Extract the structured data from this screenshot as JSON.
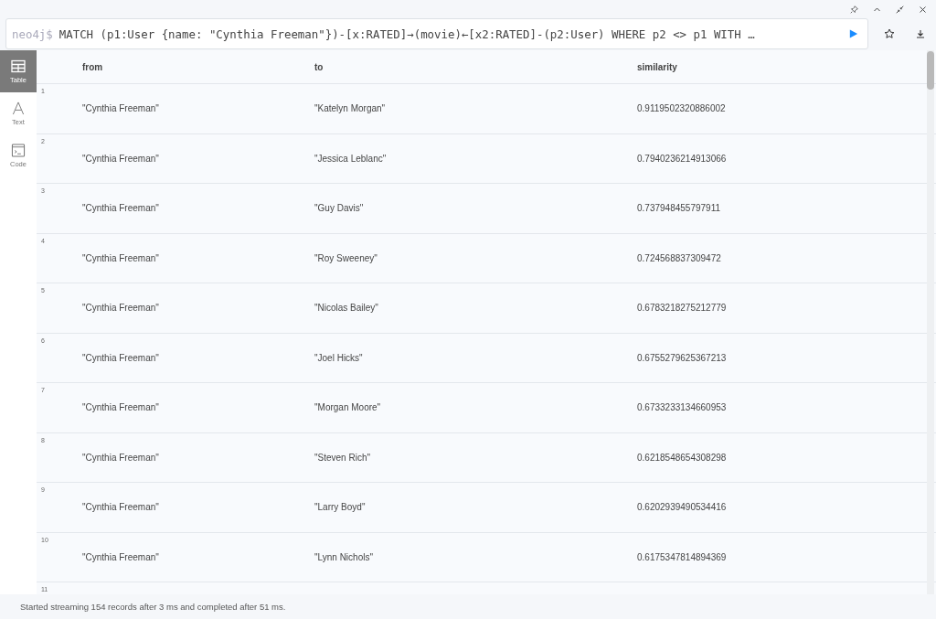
{
  "query": {
    "prompt": "neo4j$",
    "text": "MATCH (p1:User {name: \"Cynthia Freeman\"})-[x:RATED]→(movie)←[x2:RATED]-(p2:User) WHERE p2 <> p1 WITH …"
  },
  "view_tabs": [
    {
      "label": "Table",
      "kind": "table",
      "selected": true
    },
    {
      "label": "Text",
      "kind": "text",
      "selected": false
    },
    {
      "label": "Code",
      "kind": "code",
      "selected": false
    }
  ],
  "table": {
    "columns": [
      "from",
      "to",
      "similarity"
    ],
    "rows": [
      {
        "index": "1",
        "cells": [
          "\"Cynthia Freeman\"",
          "\"Katelyn Morgan\"",
          "0.9119502320886002"
        ]
      },
      {
        "index": "2",
        "cells": [
          "\"Cynthia Freeman\"",
          "\"Jessica Leblanc\"",
          "0.7940236214913066"
        ]
      },
      {
        "index": "3",
        "cells": [
          "\"Cynthia Freeman\"",
          "\"Guy Davis\"",
          "0.737948455797911"
        ]
      },
      {
        "index": "4",
        "cells": [
          "\"Cynthia Freeman\"",
          "\"Roy Sweeney\"",
          "0.724568837309472"
        ]
      },
      {
        "index": "5",
        "cells": [
          "\"Cynthia Freeman\"",
          "\"Nicolas Bailey\"",
          "0.6783218275212779"
        ]
      },
      {
        "index": "6",
        "cells": [
          "\"Cynthia Freeman\"",
          "\"Joel Hicks\"",
          "0.6755279625367213"
        ]
      },
      {
        "index": "7",
        "cells": [
          "\"Cynthia Freeman\"",
          "\"Morgan Moore\"",
          "0.6733233134660953"
        ]
      },
      {
        "index": "8",
        "cells": [
          "\"Cynthia Freeman\"",
          "\"Steven Rich\"",
          "0.6218548654308298"
        ]
      },
      {
        "index": "9",
        "cells": [
          "\"Cynthia Freeman\"",
          "\"Larry Boyd\"",
          "0.6202939490534416"
        ]
      },
      {
        "index": "10",
        "cells": [
          "\"Cynthia Freeman\"",
          "\"Lynn Nichols\"",
          "0.6175347814894369"
        ]
      },
      {
        "index": "11",
        "cells": []
      }
    ]
  },
  "status": "Started streaming 154 records after 3 ms and completed after 51 ms."
}
